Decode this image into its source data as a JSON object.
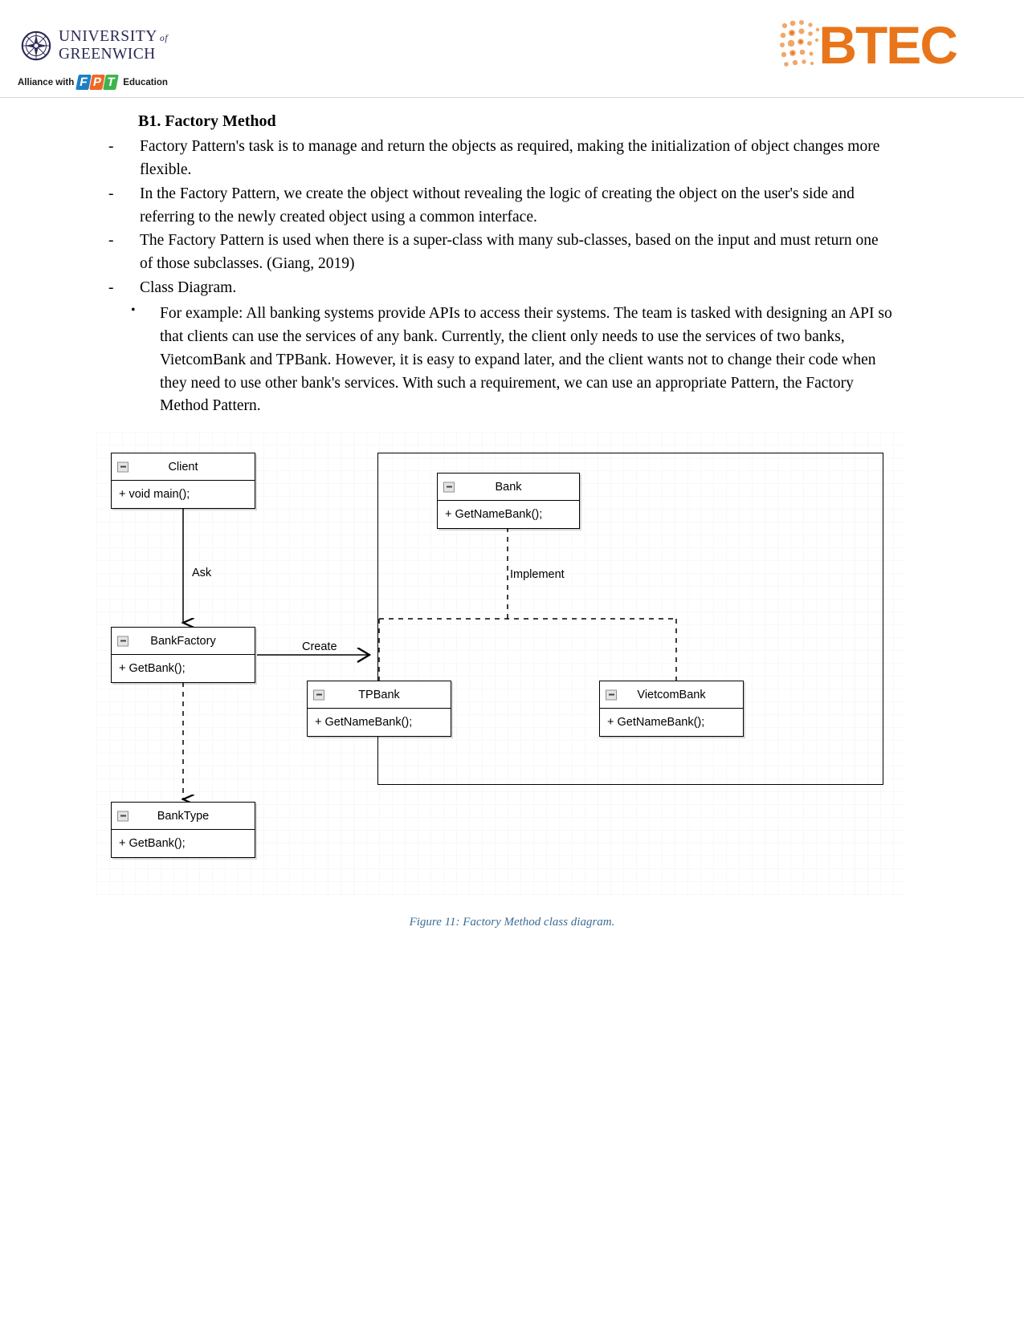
{
  "header": {
    "university_line1": "UNIVERSITY",
    "university_of": "of",
    "university_line2": "GREENWICH",
    "alliance_text": "Alliance with",
    "fpt_f": "F",
    "fpt_p": "P",
    "fpt_t": "T",
    "fpt_education": "Education",
    "btec_text": "BTEC",
    "btec_color": "#e8751a"
  },
  "content": {
    "heading": "B1. Factory Method",
    "dash_items": [
      "Factory Pattern's task is to manage and return the objects as required, making the initialization of object changes more flexible.",
      "In the Factory Pattern, we create the object without revealing the logic of creating the object on the user's side and referring to the newly created object using a common interface.",
      "The Factory Pattern is used when there is a super-class with many sub-classes, based on the input and must return one of those subclasses. (Giang, 2019)",
      "Class Diagram."
    ],
    "dash_marker": "-",
    "bullet_marker": "•",
    "bullet_items": [
      "For example: All banking systems provide APIs to access their systems. The team is tasked with designing an API so that clients can use the services of any bank. Currently, the client only needs to use the services of two banks, VietcomBank and TPBank. However, it is easy to expand later, and the client wants not to change their code when they need to use other bank's services. With such a requirement, we can use an appropriate Pattern, the Factory Method Pattern."
    ]
  },
  "diagram": {
    "type": "uml-class-diagram",
    "classes": [
      {
        "id": "client",
        "name": "Client",
        "members": [
          "+ void main();"
        ]
      },
      {
        "id": "bankfactory",
        "name": "BankFactory",
        "members": [
          "+ GetBank();"
        ]
      },
      {
        "id": "banktype",
        "name": "BankType",
        "members": [
          "+ GetBank();"
        ]
      },
      {
        "id": "bank",
        "name": "Bank",
        "members": [
          "+ GetNameBank();"
        ]
      },
      {
        "id": "tpbank",
        "name": "TPBank",
        "members": [
          "+ GetNameBank();"
        ]
      },
      {
        "id": "vietcombank",
        "name": "VietcomBank",
        "members": [
          "+ GetNameBank();"
        ]
      }
    ],
    "edges": [
      {
        "from": "client",
        "to": "bankfactory",
        "label": "Ask",
        "style": "solid"
      },
      {
        "from": "bankfactory",
        "to": "container",
        "label": "Create",
        "style": "solid"
      },
      {
        "from": "bankfactory",
        "to": "banktype",
        "label": "",
        "style": "dashed"
      },
      {
        "from": "tpbank",
        "to": "bank",
        "label": "Implement",
        "style": "dashed"
      },
      {
        "from": "vietcombank",
        "to": "bank",
        "label": "",
        "style": "dashed"
      }
    ]
  },
  "figure": {
    "caption": "Figure 11: Factory Method class diagram.",
    "caption_color": "#3c6c94"
  }
}
